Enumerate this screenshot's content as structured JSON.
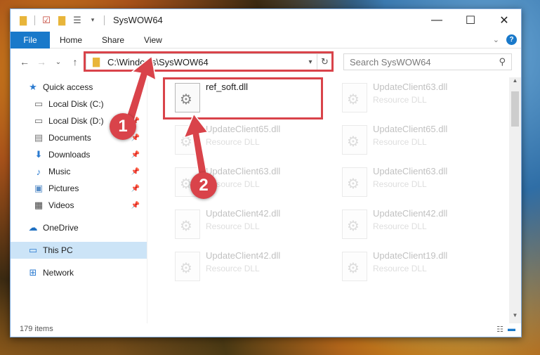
{
  "window": {
    "title": "SysWOW64",
    "controls": {
      "minimize": "—",
      "maximize": "☐",
      "close": "✕"
    }
  },
  "ribbon": {
    "file": "File",
    "tabs": [
      "Home",
      "Share",
      "View"
    ]
  },
  "nav": {
    "back": "←",
    "forward": "→",
    "recent": "⌄",
    "up": "↑",
    "address": "C:\\Windows\\SysWOW64",
    "search_placeholder": "Search SysWOW64"
  },
  "sidebar": {
    "items": [
      {
        "label": "Quick access",
        "icon": "star-icon",
        "pinned": false
      },
      {
        "label": "Local Disk (C:)",
        "icon": "drive-icon",
        "pinned": true
      },
      {
        "label": "Local Disk (D:)",
        "icon": "drive-icon",
        "pinned": true
      },
      {
        "label": "Documents",
        "icon": "documents-icon",
        "pinned": true
      },
      {
        "label": "Downloads",
        "icon": "download-icon",
        "pinned": true
      },
      {
        "label": "Music",
        "icon": "music-icon",
        "pinned": true
      },
      {
        "label": "Pictures",
        "icon": "pictures-icon",
        "pinned": true
      },
      {
        "label": "Videos",
        "icon": "videos-icon",
        "pinned": true
      },
      {
        "label": "OneDrive",
        "icon": "cloud-icon",
        "pinned": false
      },
      {
        "label": "This PC",
        "icon": "computer-icon",
        "pinned": false,
        "selected": true
      },
      {
        "label": "Network",
        "icon": "network-icon",
        "pinned": false
      }
    ]
  },
  "files": [
    {
      "name": "ref_soft.dll",
      "type": "",
      "faded": false
    },
    {
      "name": "UpdateClient63.dll",
      "type": "Resource DLL",
      "faded": true
    },
    {
      "name": "UpdateClient65.dll",
      "type": "Resource DLL",
      "faded": true
    },
    {
      "name": "UpdateClient65.dll",
      "type": "Resource DLL",
      "faded": true
    },
    {
      "name": "UpdateClient63.dll",
      "type": "Resource DLL",
      "faded": true
    },
    {
      "name": "UpdateClient63.dll",
      "type": "Resource DLL",
      "faded": true
    },
    {
      "name": "UpdateClient42.dll",
      "type": "Resource DLL",
      "faded": true
    },
    {
      "name": "UpdateClient42.dll",
      "type": "Resource DLL",
      "faded": true
    },
    {
      "name": "UpdateClient42.dll",
      "type": "Resource DLL",
      "faded": true
    },
    {
      "name": "UpdateClient19.dll",
      "type": "Resource DLL",
      "faded": true
    }
  ],
  "status": {
    "items": "179 items"
  },
  "annotations": {
    "step1": "1",
    "step2": "2",
    "color": "#d9434a"
  }
}
